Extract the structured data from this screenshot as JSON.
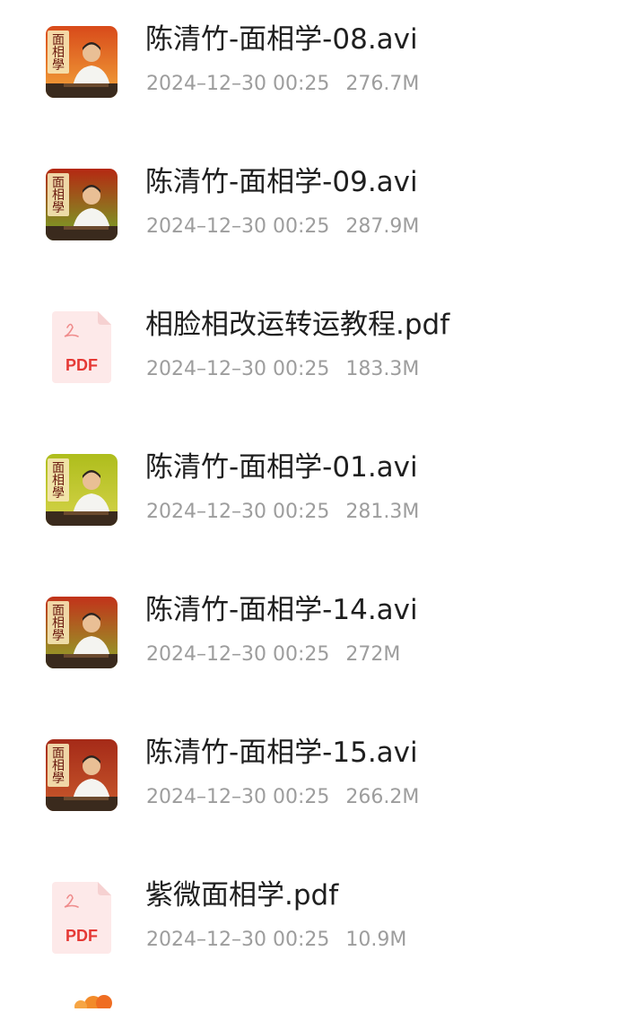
{
  "files": [
    {
      "name": "陈清竹-面相学-08.avi",
      "date": "2024–12–30 00:25",
      "size": "276.7M",
      "icon": "video-thumbnail-icon",
      "bg": [
        "#d84a1a",
        "#f3a53a"
      ]
    },
    {
      "name": "陈清竹-面相学-09.avi",
      "date": "2024–12–30 00:25",
      "size": "287.9M",
      "icon": "video-thumbnail-icon",
      "bg": [
        "#b52812",
        "#74a928"
      ]
    },
    {
      "name": "相脸相改运转运教程.pdf",
      "date": "2024–12–30 00:25",
      "size": "183.3M",
      "icon": "pdf-file-icon",
      "label": "PDF"
    },
    {
      "name": "陈清竹-面相学-01.avi",
      "date": "2024–12–30 00:25",
      "size": "281.3M",
      "icon": "video-thumbnail-icon",
      "bg": [
        "#aebd1c",
        "#d6d44a"
      ]
    },
    {
      "name": "陈清竹-面相学-14.avi",
      "date": "2024–12–30 00:25",
      "size": "272M",
      "icon": "video-thumbnail-icon",
      "bg": [
        "#c2321a",
        "#8ea82a"
      ]
    },
    {
      "name": "陈清竹-面相学-15.avi",
      "date": "2024–12–30 00:25",
      "size": "266.2M",
      "icon": "video-thumbnail-icon",
      "bg": [
        "#a52a18",
        "#c95a2c"
      ]
    },
    {
      "name": "紫微面相学.pdf",
      "date": "2024–12–30 00:25",
      "size": "10.9M",
      "icon": "pdf-file-icon",
      "label": "PDF"
    }
  ],
  "thumb_text": "面相學",
  "colors": {
    "pdf_red": "#e53935",
    "name_text": "#1f1f1f",
    "meta_text": "#9d9d9d"
  }
}
